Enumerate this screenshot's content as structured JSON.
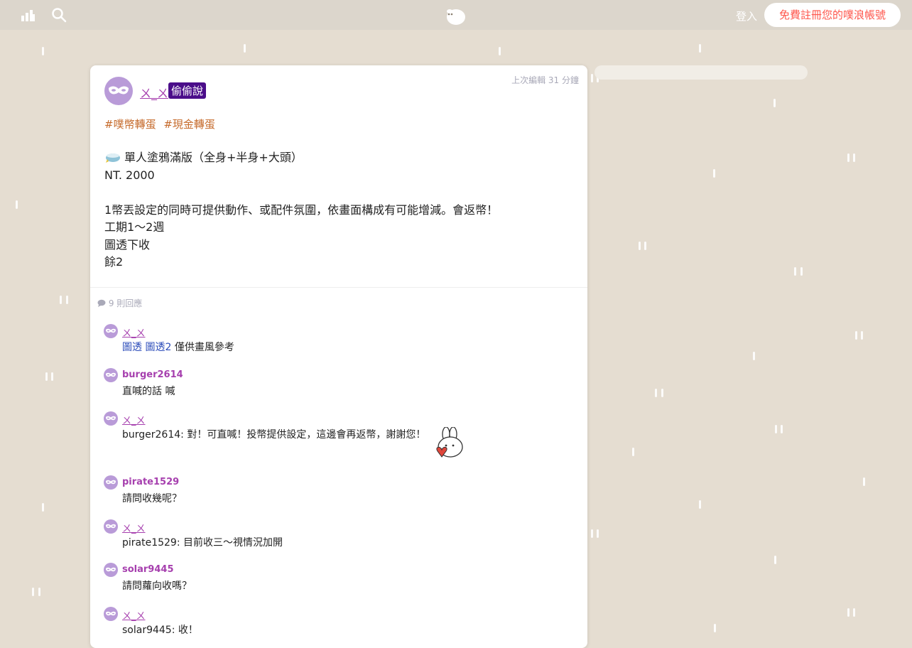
{
  "header": {
    "login_label": "登入",
    "signup_label": "免費註冊您的噗浪帳號",
    "accent_color": "#ff574d"
  },
  "plurk": {
    "author": "ㄨ_ㄨ",
    "badge": "偷偷說",
    "edited": "上次編輯 31 分鐘",
    "tags": [
      "#噗幣轉蛋",
      "#現金轉蛋"
    ],
    "content_lines": [
      "單人塗鴉滿版（全身+半身+大頭）",
      "NT. 2000",
      "",
      "1幣丟設定的同時可提供動作、或配件氛圍，依畫面構成有可能增減。會返幣！",
      "工期1～2週",
      "圖透下收",
      "餘2"
    ],
    "reply_count": "9 則回應"
  },
  "responses": [
    {
      "name": "ㄨ_ㄨ",
      "anon": true,
      "link1": "圖透",
      "link2": "圖透2",
      "text": " 僅供畫風參考"
    },
    {
      "name": "burger2614",
      "anon": false,
      "text": "直喊的話 喊"
    },
    {
      "name": "ㄨ_ㄨ",
      "anon": true,
      "text": "burger2614: 對！可直喊！投幣提供設定，這邊會再返幣，謝謝您！"
    },
    {
      "name": "pirate1529",
      "anon": false,
      "text": "請問收幾呢？"
    },
    {
      "name": "ㄨ_ㄨ",
      "anon": true,
      "text": "pirate1529: 目前收三～視情況加開"
    },
    {
      "name": "solar9445",
      "anon": false,
      "text": "請問蘿向收嗎？"
    },
    {
      "name": "ㄨ_ㄨ",
      "anon": true,
      "text": "solar9445: 收！"
    }
  ]
}
